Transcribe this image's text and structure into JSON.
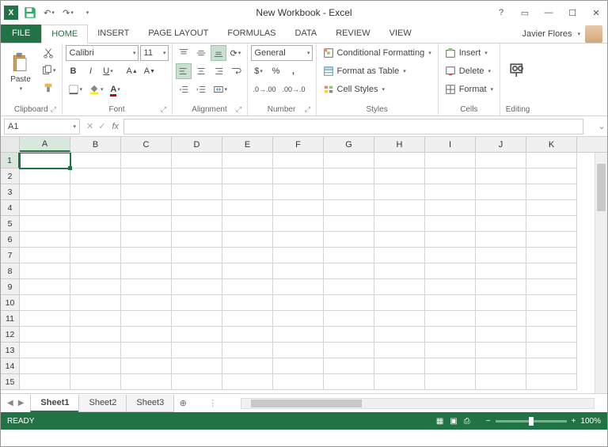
{
  "titlebar": {
    "title": "New Workbook - Excel"
  },
  "tabs": {
    "file": "FILE",
    "home": "HOME",
    "insert": "INSERT",
    "pageLayout": "PAGE LAYOUT",
    "formulas": "FORMULAS",
    "data": "DATA",
    "review": "REVIEW",
    "view": "VIEW"
  },
  "user": {
    "name": "Javier Flores"
  },
  "ribbon": {
    "clipboard": {
      "paste": "Paste",
      "label": "Clipboard"
    },
    "font": {
      "name": "Calibri",
      "size": "11",
      "label": "Font"
    },
    "alignment": {
      "label": "Alignment"
    },
    "number": {
      "format": "General",
      "label": "Number"
    },
    "styles": {
      "cond": "Conditional Formatting",
      "table": "Format as Table",
      "cell": "Cell Styles",
      "label": "Styles"
    },
    "cells": {
      "insert": "Insert",
      "delete": "Delete",
      "format": "Format",
      "label": "Cells"
    },
    "editing": {
      "label": "Editing"
    }
  },
  "nameBox": "A1",
  "columns": [
    "A",
    "B",
    "C",
    "D",
    "E",
    "F",
    "G",
    "H",
    "I",
    "J",
    "K"
  ],
  "rows": [
    "1",
    "2",
    "3",
    "4",
    "5",
    "6",
    "7",
    "8",
    "9",
    "10",
    "11",
    "12",
    "13",
    "14",
    "15"
  ],
  "sheets": {
    "s1": "Sheet1",
    "s2": "Sheet2",
    "s3": "Sheet3"
  },
  "status": {
    "ready": "READY",
    "zoom": "100%"
  }
}
